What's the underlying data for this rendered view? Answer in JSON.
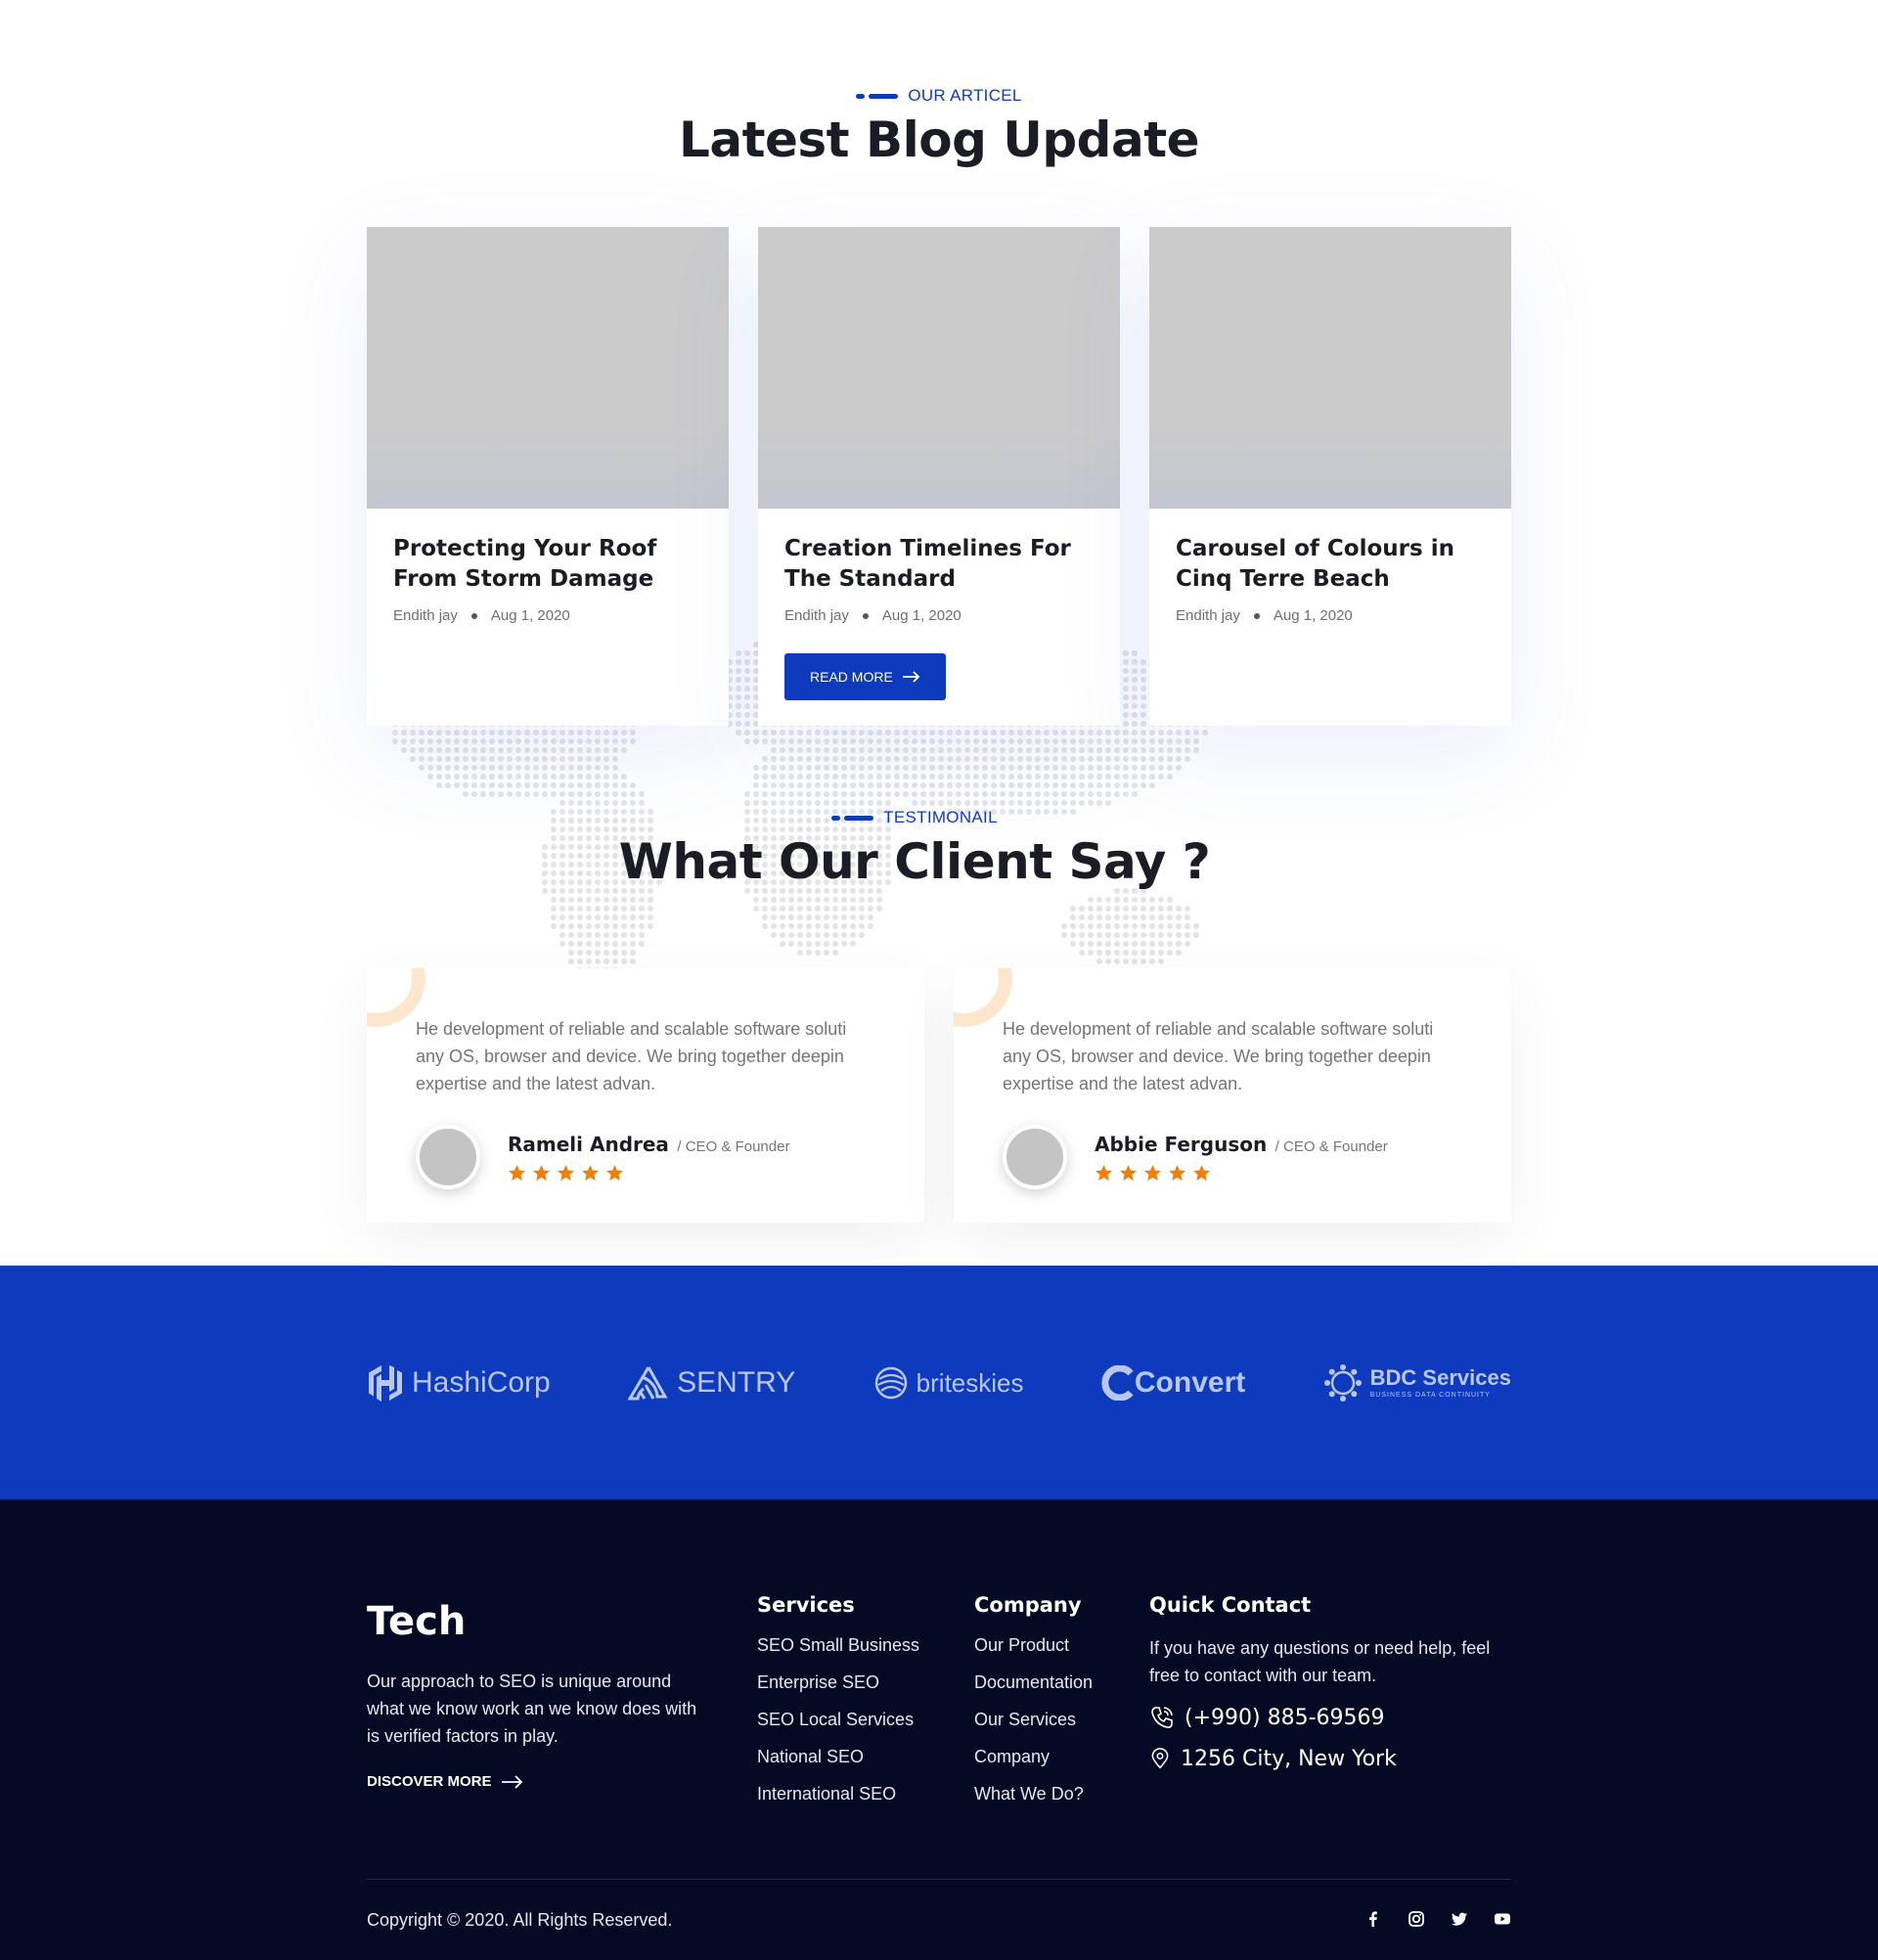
{
  "blog": {
    "eyebrow": "OUR ARTICEL",
    "title": "Latest Blog Update",
    "posts": [
      {
        "title": "Protecting Your Roof From Storm Damage",
        "author": "Endith jay",
        "date": "Aug 1, 2020"
      },
      {
        "title": "Creation Timelines For The Standard",
        "author": "Endith jay",
        "date": "Aug 1, 2020",
        "button": "READ MORE"
      },
      {
        "title": "Carousel of Colours in Cinq Terre Beach",
        "author": "Endith jay",
        "date": "Aug 1, 2020"
      }
    ]
  },
  "testimonials": {
    "eyebrow": "TESTIMONAIL",
    "title": "What Our Client Say ?",
    "items": [
      {
        "text": "He development of reliable and scalable software soluti any OS, browser and device. We bring together deepin expertise and the latest advan.",
        "name": "Rameli Andrea",
        "role": "/ CEO & Founder",
        "rating": 5
      },
      {
        "text": "He development of reliable and scalable software soluti any OS, browser and device. We bring together deepin expertise and the latest advan.",
        "name": "Abbie Ferguson",
        "role": "/ CEO & Founder",
        "rating": 5
      }
    ]
  },
  "partners": {
    "logos": [
      {
        "name": "HashiCorp",
        "icon": "hashicorp-logo"
      },
      {
        "name": "SENTRY",
        "icon": "sentry-logo"
      },
      {
        "name": "briteskies",
        "icon": "briteskies-logo"
      },
      {
        "name": "Convert",
        "icon": "convert-logo"
      },
      {
        "name": "BDC Services",
        "sub": "BUSINESS DATA CONTINUITY",
        "icon": "bdc-logo"
      }
    ]
  },
  "footer": {
    "brand": "Tech",
    "about": "Our approach to SEO is unique around what we know work an we know does with is verified factors in play.",
    "discover": "DISCOVER MORE",
    "services": {
      "title": "Services",
      "items": [
        "SEO Small Business",
        "Enterprise SEO",
        "SEO Local Services",
        "National SEO",
        "International SEO"
      ]
    },
    "company": {
      "title": "Company",
      "items": [
        "Our Product",
        "Documentation",
        "Our Services",
        "Company",
        "What We Do?"
      ]
    },
    "contact": {
      "title": "Quick Contact",
      "text": "If you have any questions or need help, feel free to contact with our team.",
      "phone": "(+990) 885-69569",
      "address": "1256 City, New York"
    },
    "copyright": "Copyright © 2020. All Rights Reserved.",
    "social": [
      "facebook-icon",
      "instagram-icon",
      "twitter-icon",
      "youtube-icon"
    ]
  },
  "colors": {
    "accent": "#0e3bbd",
    "star": "#f07e0a",
    "footer_bg": "#050a24"
  }
}
